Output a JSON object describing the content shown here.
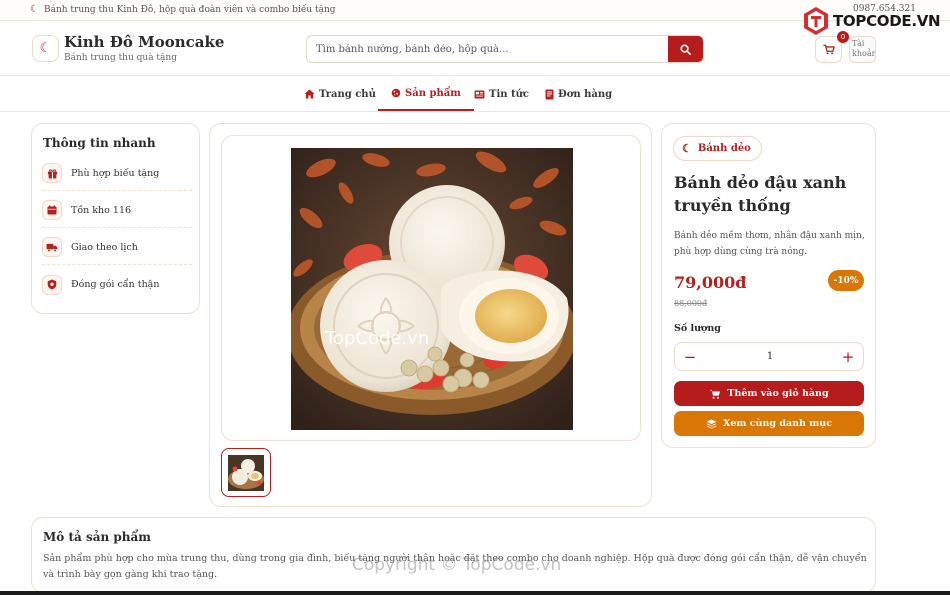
{
  "topbar": {
    "announcement": "Bánh trung thu Kinh Đô, hộp quà đoàn viên và combo biếu tặng",
    "phone": "0987.654.321"
  },
  "header": {
    "brand_name": "Kinh Đô Mooncake",
    "brand_tagline": "Bánh trung thu quà tặng",
    "search_placeholder": "Tìm bánh nướng, bánh dẻo, hộp quà...",
    "cart_count": "0",
    "avatar_alt": "Tài khoản"
  },
  "nav": {
    "items": [
      {
        "label": "Trang chủ",
        "icon": "home-icon"
      },
      {
        "label": "Sản phẩm",
        "icon": "cookie-icon",
        "active": true
      },
      {
        "label": "Tin tức",
        "icon": "newspaper-icon"
      },
      {
        "label": "Đơn hàng",
        "icon": "receipt-icon"
      }
    ]
  },
  "quick_info": {
    "title": "Thông tin nhanh",
    "items": [
      {
        "label": "Phù hợp biếu tặng",
        "icon": "gift-icon"
      },
      {
        "label": "Tồn kho 116",
        "icon": "calendar-icon"
      },
      {
        "label": "Giao theo lịch",
        "icon": "truck-icon"
      },
      {
        "label": "Đóng gói cẩn thận",
        "icon": "shield-icon"
      }
    ]
  },
  "product": {
    "category": "Bánh dẻo",
    "title": "Bánh dẻo đậu xanh truyền thống",
    "description": "Bánh dẻo mềm thơm, nhân đậu xanh mịn, phù hợp dùng cùng trà nóng.",
    "price": "79,000đ",
    "discount": "-10%",
    "old_price": "88,000đ",
    "quantity_label": "Số lượng",
    "quantity": "1",
    "add_to_cart_label": "Thêm vào giỏ hàng",
    "view_category_label": "Xem cùng danh mục"
  },
  "description": {
    "title": "Mô tả sản phẩm",
    "text": "Sản phẩm phù hợp cho mùa trung thu, dùng trong gia đình, biếu tặng người thân hoặc đặt theo combo cho doanh nghiệp. Hộp quà được đóng gói cẩn thận, dễ vận chuyển và trình bày gọn gàng khi trao tặng."
  },
  "watermarks": {
    "brand_logo": "TOPCODE.VN",
    "overlay_mid": "TopCode.vn",
    "overlay_bottom": "Copyright © TopCode.vn"
  },
  "colors": {
    "primary": "#b71c1c",
    "accent": "#d97706",
    "border": "#efe1cf"
  }
}
